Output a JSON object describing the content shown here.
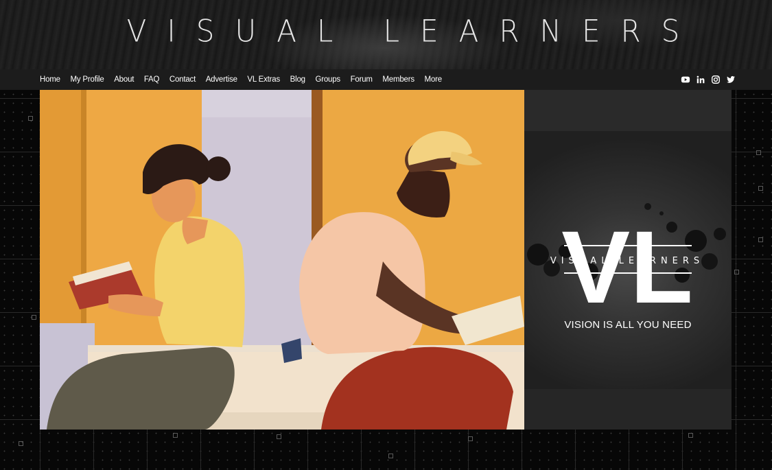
{
  "site": {
    "title": "VISUAL LEARNERS"
  },
  "nav": {
    "items": [
      {
        "label": "Home"
      },
      {
        "label": "My Profile"
      },
      {
        "label": "About"
      },
      {
        "label": "FAQ"
      },
      {
        "label": "Contact"
      },
      {
        "label": "Advertise"
      },
      {
        "label": "VL Extras"
      },
      {
        "label": "Blog"
      },
      {
        "label": "Groups"
      },
      {
        "label": "Forum"
      },
      {
        "label": "Members"
      },
      {
        "label": "More"
      }
    ],
    "socials": [
      "youtube-icon",
      "linkedin-icon",
      "instagram-icon",
      "twitter-icon"
    ]
  },
  "logo_panel": {
    "monogram": "VL",
    "wordmark": "VISUAL LEARNERS",
    "tagline": "VISION IS ALL YOU NEED"
  },
  "colors": {
    "background": "#0a0a0a",
    "nav_bar": "#1c1c1c",
    "illustration_bg": "#eea844"
  }
}
